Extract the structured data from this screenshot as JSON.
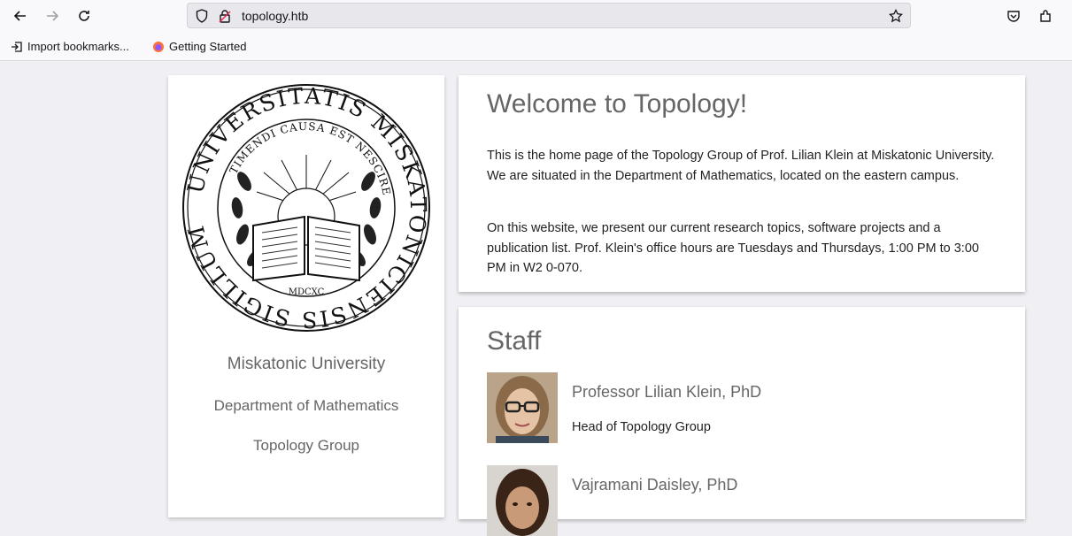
{
  "browser": {
    "url": "topology.htb",
    "bookmarks": [
      {
        "label": "Import bookmarks..."
      },
      {
        "label": "Getting Started"
      }
    ]
  },
  "sidebar": {
    "seal": {
      "outer_text": "UNIVERSITATIS MISKATONICIENSIS SIGILLUM",
      "inner_text": "TIMENDI CAUSA EST NESCIRE",
      "year": "MDCXC"
    },
    "university": "Miskatonic University",
    "department": "Department of Mathematics",
    "group": "Topology Group"
  },
  "welcome": {
    "title": "Welcome to Topology!",
    "paragraph1": "This is the home page of the Topology Group of Prof. Lilian Klein at Miskatonic University. We are situated in the Department of Mathematics, located on the eastern campus.",
    "paragraph2": "On this website, we present our current research topics, software projects and a publication list. Prof. Klein's office hours are Tuesdays and Thursdays, 1:00 PM to 3:00 PM in W2 0-070."
  },
  "staff": {
    "title": "Staff",
    "members": [
      {
        "name": "Professor Lilian Klein, PhD",
        "role": "Head of Topology Group"
      },
      {
        "name": "Vajramani Daisley, PhD",
        "role": ""
      }
    ]
  }
}
